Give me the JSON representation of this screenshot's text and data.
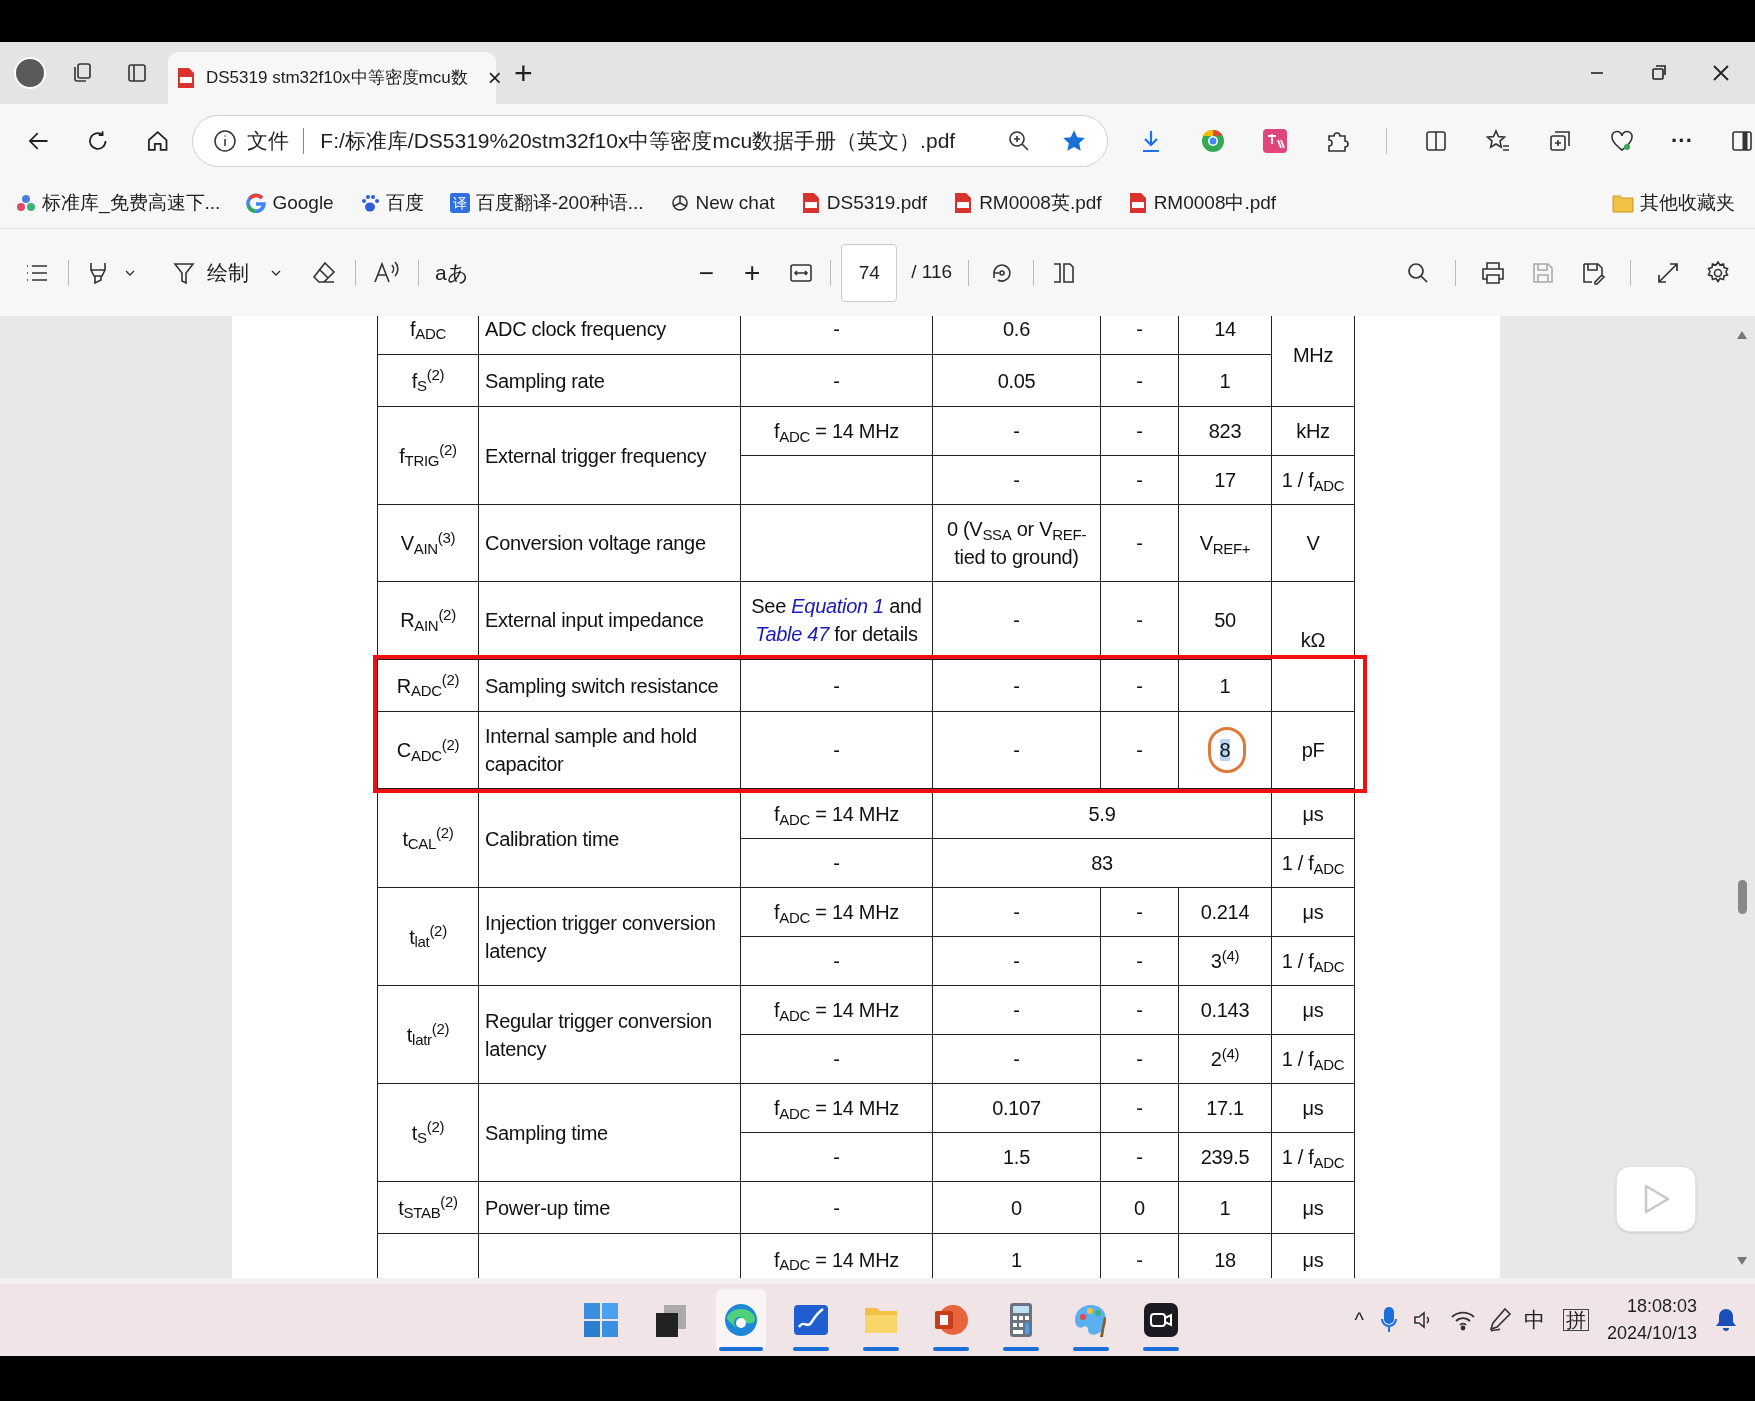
{
  "tab": {
    "title": "DS5319 stm32f10x中等密度mcu数",
    "close": "×",
    "new_tab": "+"
  },
  "address": {
    "scheme_label": "文件",
    "url": "F:/标准库/DS5319%20stm32f10x中等密度mcu数据手册（英文）.pdf",
    "more": "···"
  },
  "bookmarks": [
    {
      "label": "标准库_免费高速下...",
      "kind": "site"
    },
    {
      "label": "Google",
      "kind": "google"
    },
    {
      "label": "百度",
      "kind": "paw"
    },
    {
      "label": "百度翻译-200种语...",
      "kind": "glyph",
      "glyph": "译"
    },
    {
      "label": "New chat",
      "kind": "chat"
    },
    {
      "label": "DS5319.pdf",
      "kind": "pdf"
    },
    {
      "label": "RM0008英.pdf",
      "kind": "pdf"
    },
    {
      "label": "RM0008中.pdf",
      "kind": "pdf"
    }
  ],
  "other_favorites": "其他收藏夹",
  "pdf_toolbar": {
    "draw_label": "绘制",
    "translate_label": "aあ",
    "zoom_out": "−",
    "zoom_in": "+",
    "page": "74",
    "page_total": "/ 116"
  },
  "table": {
    "groups": [
      {
        "symbol": "f$_{ADC}$",
        "parameter": "ADC clock frequency",
        "boxed": false,
        "lines": [
          {
            "kind": "normal",
            "conditions": "-",
            "min": "0.6",
            "typ": "-",
            "max": "14",
            "unit": "MHz"
          }
        ]
      },
      {
        "symbol": "f$_{S}$$^{(2)}$",
        "parameter": "Sampling rate",
        "boxed": false,
        "lines": [
          {
            "kind": "normal",
            "conditions": "-",
            "min": "0.05",
            "typ": "-",
            "max": "1"
          }
        ]
      },
      {
        "symbol": "f$_{TRIG}$$^{(2)}$",
        "parameter": "External trigger frequency",
        "boxed": false,
        "lines": [
          {
            "kind": "normal",
            "conditions": "f$_{ADC}$ = 14 MHz",
            "min": "-",
            "typ": "-",
            "max": "823",
            "unit": "kHz"
          },
          {
            "kind": "normal",
            "min": "-",
            "typ": "-",
            "max": "17",
            "unit": "1 / f$_{ADC}$"
          }
        ]
      },
      {
        "symbol": "V$_{AIN}$$^{(3)}$",
        "parameter": "Conversion voltage range",
        "boxed": false,
        "lines": [
          {
            "kind": "normal",
            "min": "0 (V$_{SSA}$ or V$_{REF-}$ tied to ground)",
            "typ": "-",
            "max": "V$_{REF+}$",
            "unit": "V"
          }
        ]
      },
      {
        "symbol": "R$_{AIN}$$^{(2)}$",
        "parameter": "External input impedance",
        "boxed": false,
        "lines": [
          {
            "kind": "normal",
            "conditions_parts": [
              {
                "kind": "text",
                "text": "See "
              },
              {
                "kind": "link",
                "text": "Equation 1"
              },
              {
                "kind": "text",
                "text": " and "
              },
              {
                "kind": "link",
                "text": "Table 47"
              },
              {
                "kind": "text",
                "text": " for details"
              }
            ],
            "min": "-",
            "typ": "-",
            "max": "50",
            "unit": "kΩ"
          }
        ]
      },
      {
        "symbol": "R$_{ADC}$$^{(2)}$",
        "parameter": "Sampling switch resistance",
        "boxed": true,
        "lines": [
          {
            "kind": "normal",
            "conditions": "-",
            "min": "-",
            "typ": "-",
            "max": "1"
          }
        ]
      },
      {
        "symbol": "C$_{ADC}$$^{(2)}$",
        "parameter": "Internal sample and hold capacitor",
        "boxed": true,
        "lines": [
          {
            "kind": "normal",
            "conditions": "-",
            "min": "-",
            "typ": "-",
            "max": "8",
            "circled": true,
            "unit": "pF"
          }
        ]
      },
      {
        "symbol": "t$_{CAL}$$^{(2)}$",
        "parameter": "Calibration time",
        "boxed": false,
        "lines": [
          {
            "kind": "merged",
            "conditions": "f$_{ADC}$ = 14 MHz",
            "value": "5.9",
            "unit": "μs"
          },
          {
            "kind": "merged",
            "conditions": "-",
            "value": "83",
            "unit": "1 / f$_{ADC}$"
          }
        ]
      },
      {
        "symbol": "t$_{lat}$$^{(2)}$",
        "parameter": "Injection trigger conversion latency",
        "boxed": false,
        "lines": [
          {
            "kind": "normal",
            "conditions": "f$_{ADC}$ = 14 MHz",
            "min": "-",
            "typ": "-",
            "max": "0.214",
            "unit": "μs"
          },
          {
            "kind": "normal",
            "conditions": "-",
            "min": "-",
            "typ": "-",
            "max": "3$^{(4)}$",
            "unit": "1 / f$_{ADC}$"
          }
        ]
      },
      {
        "symbol": "t$_{latr}$$^{(2)}$",
        "parameter": "Regular trigger conversion latency",
        "boxed": false,
        "lines": [
          {
            "kind": "normal",
            "conditions": "f$_{ADC}$ = 14 MHz",
            "min": "-",
            "typ": "-",
            "max": "0.143",
            "unit": "μs"
          },
          {
            "kind": "normal",
            "conditions": "-",
            "min": "-",
            "typ": "-",
            "max": "2$^{(4)}$",
            "unit": "1 / f$_{ADC}$"
          }
        ]
      },
      {
        "symbol": "t$_{S}$$^{(2)}$",
        "parameter": "Sampling time",
        "boxed": false,
        "lines": [
          {
            "kind": "normal",
            "conditions": "f$_{ADC}$ = 14 MHz",
            "min": "0.107",
            "typ": "-",
            "max": "17.1",
            "unit": "μs"
          },
          {
            "kind": "normal",
            "conditions": "-",
            "min": "1.5",
            "typ": "-",
            "max": "239.5",
            "unit": "1 / f$_{ADC}$"
          }
        ]
      },
      {
        "symbol": "t$_{STAB}$$^{(2)}$",
        "parameter": "Power-up time",
        "boxed": false,
        "lines": [
          {
            "kind": "normal",
            "conditions": "-",
            "min": "0",
            "typ": "0",
            "max": "1",
            "unit": "μs"
          }
        ]
      },
      {
        "boxed": false,
        "lines": [
          {
            "kind": "normal",
            "conditions": "f$_{ADC}$ = 14 MHz",
            "min": "1",
            "typ": "-",
            "max": "18",
            "unit": "μs"
          }
        ]
      }
    ]
  },
  "taskbar": {
    "apps": [
      {
        "kind": "start",
        "running": false,
        "selected": false
      },
      {
        "kind": "app",
        "running": false,
        "selected": false
      },
      {
        "kind": "browser",
        "running": true,
        "selected": true
      },
      {
        "kind": "whiteboard",
        "running": true,
        "selected": false
      },
      {
        "kind": "folder",
        "running": true,
        "selected": false
      },
      {
        "kind": "slides",
        "running": true,
        "selected": false
      },
      {
        "kind": "calculator",
        "running": true,
        "selected": false
      },
      {
        "kind": "paint",
        "running": true,
        "selected": false
      },
      {
        "kind": "camera",
        "running": true,
        "selected": false
      }
    ],
    "tray": {
      "overflow": "^",
      "ime_mode": "中",
      "ime": "拼",
      "time": "18:08:03",
      "date": "2024/10/13"
    }
  }
}
